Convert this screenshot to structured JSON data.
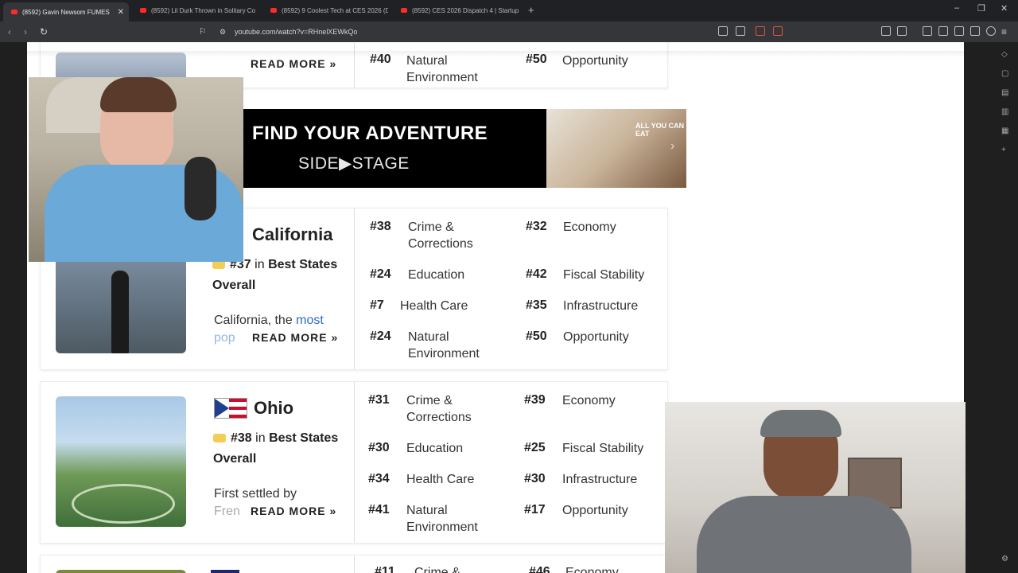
{
  "browser": {
    "tabs": [
      {
        "title": "(8592) Gavin Newsom FUMES",
        "active": true
      },
      {
        "title": "(8592) Lil Durk Thrown in Solitary Co",
        "active": false
      },
      {
        "title": "(8592) 9 Coolest Tech at CES 2026 (D",
        "active": false
      },
      {
        "title": "(8592) CES 2026 Dispatch 4 | Startup",
        "active": false
      }
    ],
    "new_tab": "+",
    "url": "youtube.com/watch?v=RHnelXEWkQo"
  },
  "top_row": {
    "partial_text": "READ MORE »",
    "rank_partial": "#40",
    "category": "Natural Environment",
    "rank2_partial": "#50",
    "category2": "Opportunity"
  },
  "ad": {
    "title": "FIND YOUR ADVENTURE",
    "brand": "SIDE▶STAGE",
    "photo_caption": "ALL YOU CAN EAT"
  },
  "states": [
    {
      "name": "California",
      "rank_num": "#37",
      "rank_in": "in",
      "rank_label": "Best States Overall",
      "blurb_start": "California, the",
      "blurb_link": "most",
      "blurb_fade": "pop",
      "read_more": "READ MORE »",
      "stats_left": [
        {
          "num": "#38",
          "label": "Crime & Corrections"
        },
        {
          "num": "#24",
          "label": "Education"
        },
        {
          "num": "#7",
          "label": "Health Care"
        },
        {
          "num": "#24",
          "label": "Natural Environment"
        }
      ],
      "stats_right": [
        {
          "num": "#32",
          "label": "Economy"
        },
        {
          "num": "#42",
          "label": "Fiscal Stability"
        },
        {
          "num": "#35",
          "label": "Infrastructure"
        },
        {
          "num": "#50",
          "label": "Opportunity"
        }
      ]
    },
    {
      "name": "Ohio",
      "rank_num": "#38",
      "rank_in": "in",
      "rank_label": "Best States Overall",
      "blurb_start": "First settled by",
      "blurb_fade": "Fren",
      "read_more": "READ MORE »",
      "stats_left": [
        {
          "num": "#31",
          "label": "Crime & Corrections"
        },
        {
          "num": "#30",
          "label": "Education"
        },
        {
          "num": "#34",
          "label": "Health Care"
        },
        {
          "num": "#41",
          "label": "Natural Environment"
        }
      ],
      "stats_right": [
        {
          "num": "#39",
          "label": "Economy"
        },
        {
          "num": "#25",
          "label": "Fiscal Stability"
        },
        {
          "num": "#30",
          "label": "Infrastructure"
        },
        {
          "num": "#17",
          "label": "Opportunity"
        }
      ]
    }
  ],
  "bottom_row": {
    "rank_partial": "#11",
    "category_partial": "Crime &",
    "rank2_partial": "#46",
    "category2_partial": "Economy"
  },
  "colors": {
    "page_bg": "#ffffff",
    "link": "#2b6cc4",
    "medal": "#f2cd58",
    "ad_bg": "#000000"
  }
}
